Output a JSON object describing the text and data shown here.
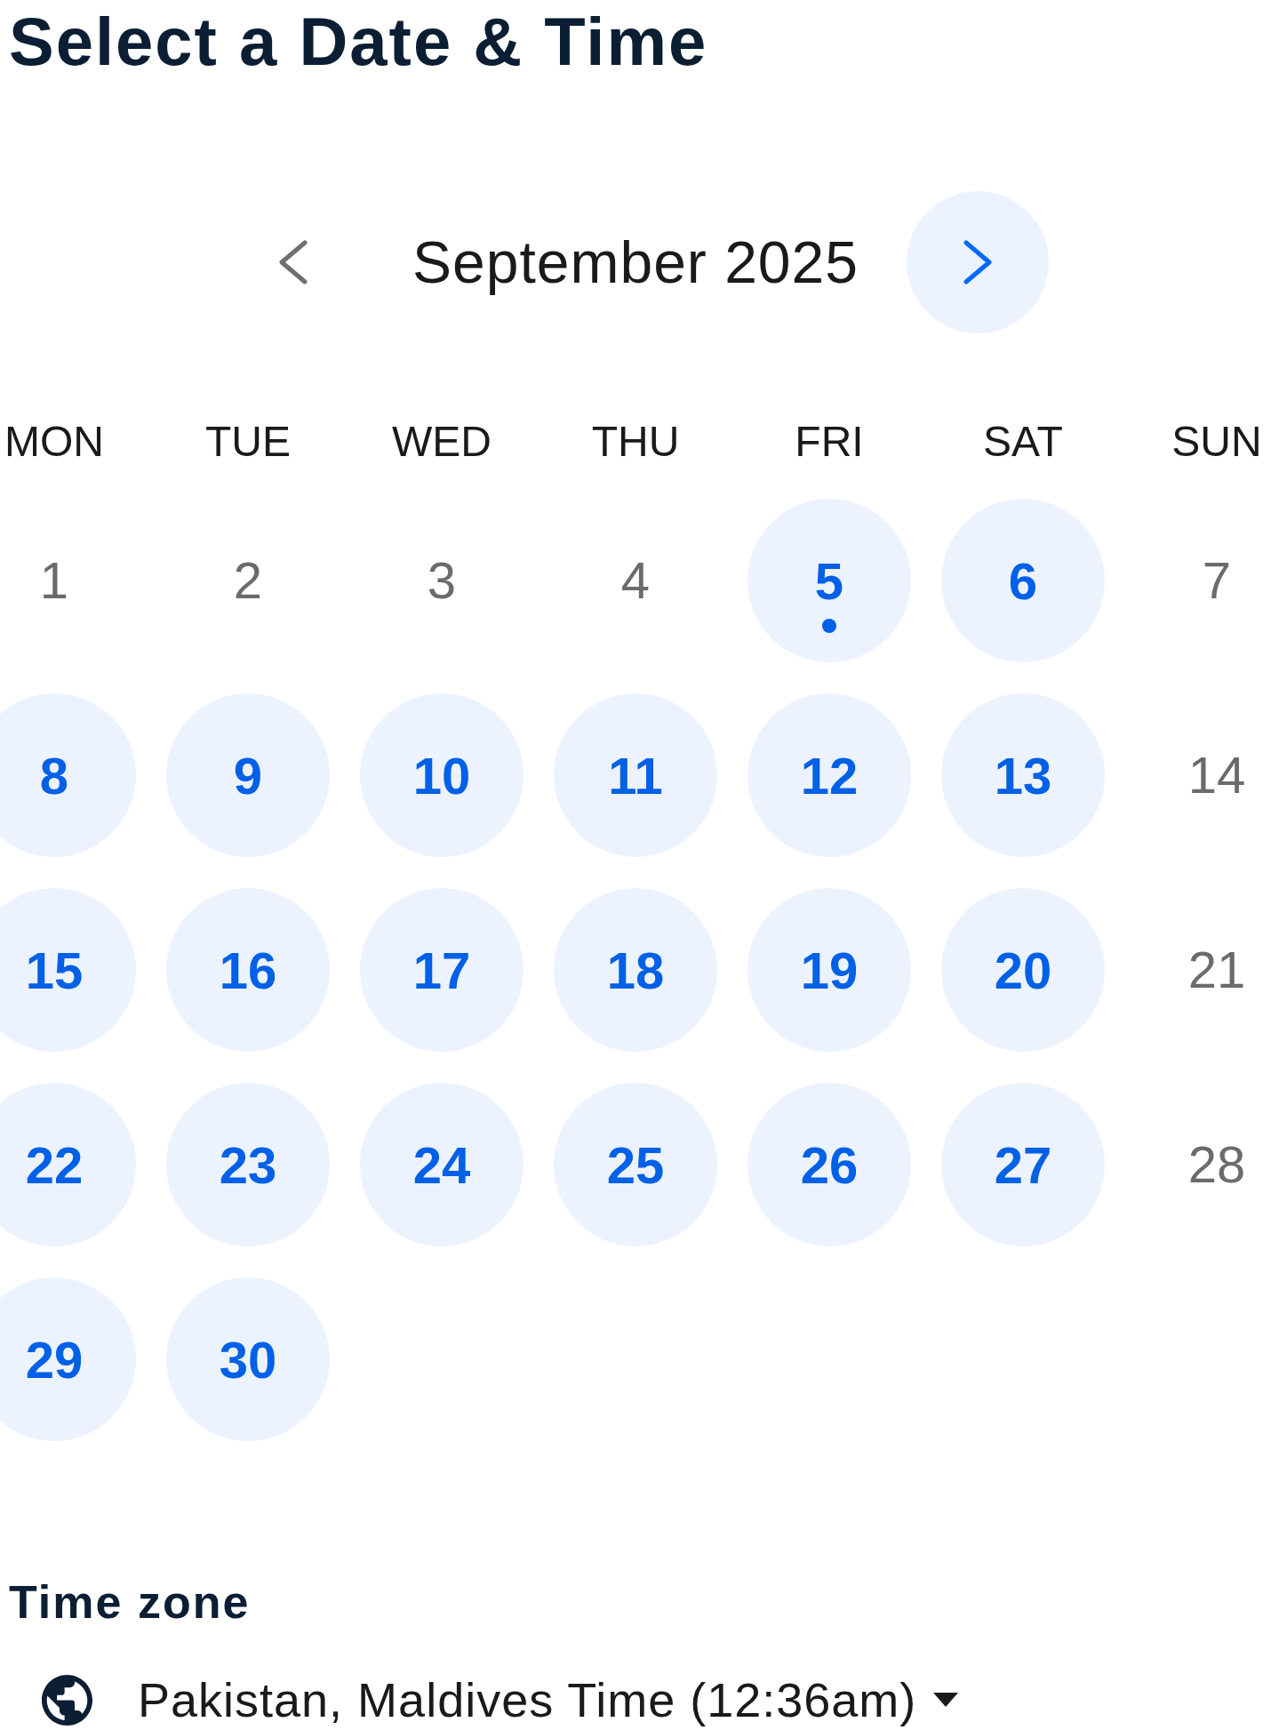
{
  "title": "Select a Date & Time",
  "month_nav": {
    "month": "September 2025",
    "prev_disabled": true,
    "next_disabled": false
  },
  "weekdays": [
    "MON",
    "TUE",
    "WED",
    "THU",
    "FRI",
    "SAT",
    "SUN"
  ],
  "days": [
    {
      "label": "1",
      "available": false,
      "today": false
    },
    {
      "label": "2",
      "available": false,
      "today": false
    },
    {
      "label": "3",
      "available": false,
      "today": false
    },
    {
      "label": "4",
      "available": false,
      "today": false
    },
    {
      "label": "5",
      "available": true,
      "today": true
    },
    {
      "label": "6",
      "available": true,
      "today": false
    },
    {
      "label": "7",
      "available": false,
      "today": false
    },
    {
      "label": "8",
      "available": true,
      "today": false
    },
    {
      "label": "9",
      "available": true,
      "today": false
    },
    {
      "label": "10",
      "available": true,
      "today": false
    },
    {
      "label": "11",
      "available": true,
      "today": false
    },
    {
      "label": "12",
      "available": true,
      "today": false
    },
    {
      "label": "13",
      "available": true,
      "today": false
    },
    {
      "label": "14",
      "available": false,
      "today": false
    },
    {
      "label": "15",
      "available": true,
      "today": false
    },
    {
      "label": "16",
      "available": true,
      "today": false
    },
    {
      "label": "17",
      "available": true,
      "today": false
    },
    {
      "label": "18",
      "available": true,
      "today": false
    },
    {
      "label": "19",
      "available": true,
      "today": false
    },
    {
      "label": "20",
      "available": true,
      "today": false
    },
    {
      "label": "21",
      "available": false,
      "today": false
    },
    {
      "label": "22",
      "available": true,
      "today": false
    },
    {
      "label": "23",
      "available": true,
      "today": false
    },
    {
      "label": "24",
      "available": true,
      "today": false
    },
    {
      "label": "25",
      "available": true,
      "today": false
    },
    {
      "label": "26",
      "available": true,
      "today": false
    },
    {
      "label": "27",
      "available": true,
      "today": false
    },
    {
      "label": "28",
      "available": false,
      "today": false
    },
    {
      "label": "29",
      "available": true,
      "today": false
    },
    {
      "label": "30",
      "available": true,
      "today": false
    }
  ],
  "time_zone": {
    "label": "Time zone",
    "value": "Pakistan, Maldives Time (12:36am)"
  }
}
